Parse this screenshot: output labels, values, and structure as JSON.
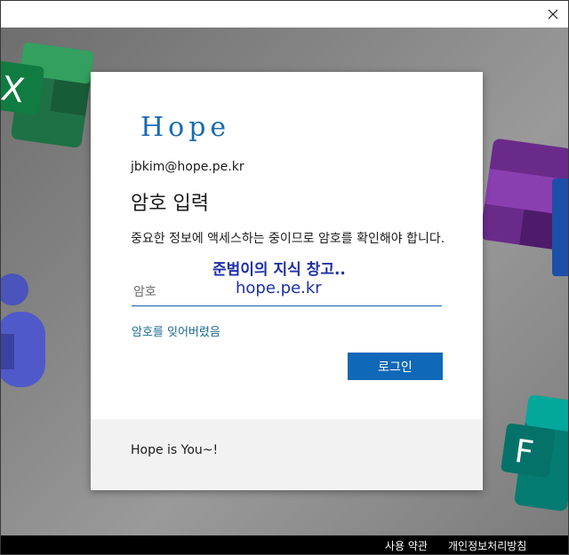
{
  "window": {
    "close_icon": "close-icon"
  },
  "dialog": {
    "logo_text": "Hope",
    "account": "jbkim@hope.pe.kr",
    "heading": "암호 입력",
    "description": "중요한 정보에 액세스하는 중이므로 암호를 확인해야 합니다.",
    "password_placeholder": "암호",
    "password_value": "",
    "forgot_link": "암호를 잊어버렸음",
    "login_button": "로그인",
    "footer_text": "Hope is You~!",
    "watermark_line1": "준범이의 지식 창고..",
    "watermark_line2": "hope.pe.kr",
    "accent_color": "#0f68b8"
  },
  "footer": {
    "terms": "사용 약관",
    "privacy": "개인정보처리방침"
  },
  "background_tiles": [
    {
      "app": "excel",
      "letter": "X"
    },
    {
      "app": "onenote",
      "letter": ""
    },
    {
      "app": "teams",
      "letter": ""
    },
    {
      "app": "forms",
      "letter": "F"
    }
  ]
}
